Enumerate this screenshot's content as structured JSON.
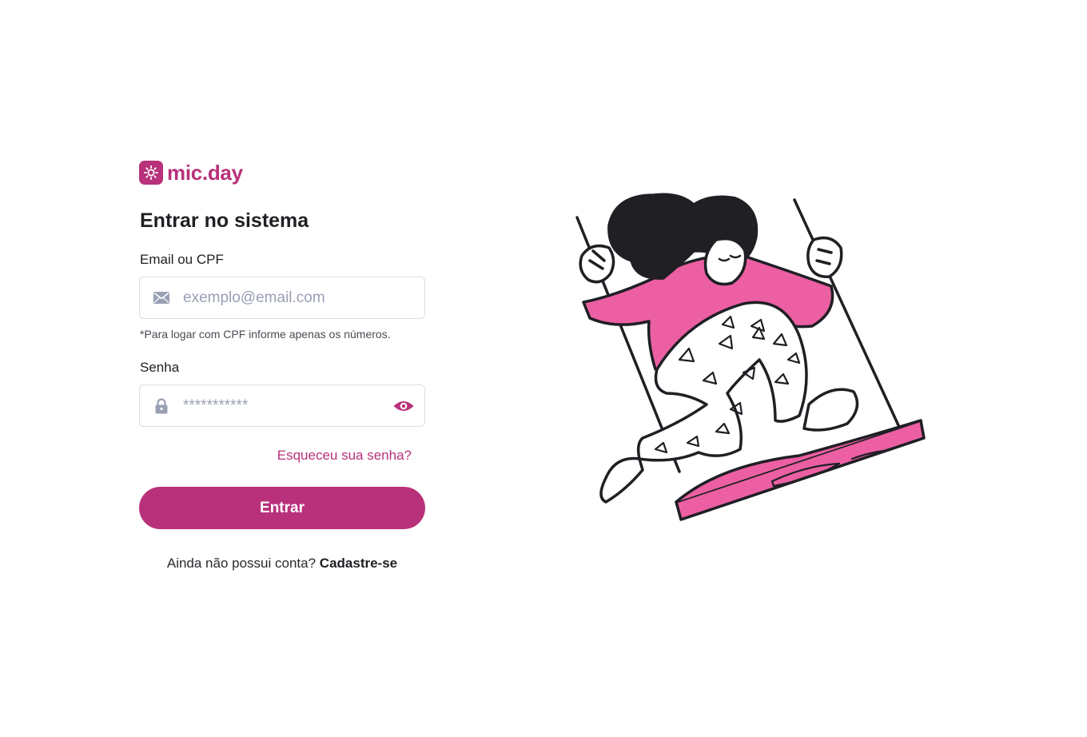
{
  "brand": {
    "name": "mic.day",
    "logo_icon": "sun-icon"
  },
  "colors": {
    "accent": "#b8317a",
    "illustration_pink": "#ec5fa3",
    "ink": "#1f1f24"
  },
  "login": {
    "title": "Entrar no sistema",
    "email": {
      "label": "Email ou CPF",
      "placeholder": "exemplo@email.com",
      "value": "",
      "icon": "mail-icon",
      "hint": "*Para logar com CPF informe apenas os números."
    },
    "password": {
      "label": "Senha",
      "placeholder": "***********",
      "value": "",
      "icon": "lock-icon",
      "toggle_icon": "eye-icon"
    },
    "forgot_label": "Esqueceu sua senha?",
    "submit_label": "Entrar",
    "signup_prompt": "Ainda não possui conta?",
    "signup_link": "Cadastre-se"
  },
  "illustration": {
    "subject": "woman-on-swing"
  }
}
